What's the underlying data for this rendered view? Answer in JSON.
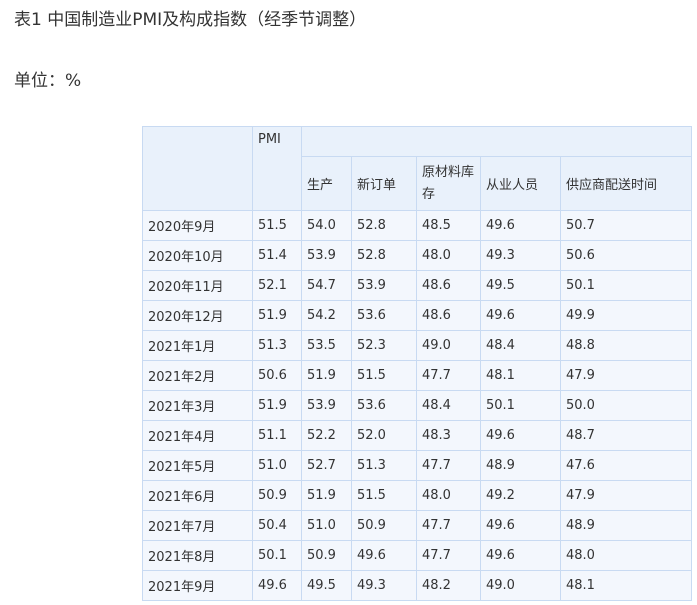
{
  "title": "表1 中国制造业PMI及构成指数（经季节调整）",
  "unit": "单位：%",
  "table": {
    "headers": {
      "pmi": "PMI",
      "production": "生产",
      "new_orders": "新订单",
      "raw_inventory": "原材料库存",
      "employees": "从业人员",
      "delivery_time": "供应商配送时间"
    },
    "rows": [
      [
        "2020年9月",
        "51.5",
        "54.0",
        "52.8",
        "48.5",
        "49.6",
        "50.7"
      ],
      [
        "2020年10月",
        "51.4",
        "53.9",
        "52.8",
        "48.0",
        "49.3",
        "50.6"
      ],
      [
        "2020年11月",
        "52.1",
        "54.7",
        "53.9",
        "48.6",
        "49.5",
        "50.1"
      ],
      [
        "2020年12月",
        "51.9",
        "54.2",
        "53.6",
        "48.6",
        "49.6",
        "49.9"
      ],
      [
        "2021年1月",
        "51.3",
        "53.5",
        "52.3",
        "49.0",
        "48.4",
        "48.8"
      ],
      [
        "2021年2月",
        "50.6",
        "51.9",
        "51.5",
        "47.7",
        "48.1",
        "47.9"
      ],
      [
        "2021年3月",
        "51.9",
        "53.9",
        "53.6",
        "48.4",
        "50.1",
        "50.0"
      ],
      [
        "2021年4月",
        "51.1",
        "52.2",
        "52.0",
        "48.3",
        "49.6",
        "48.7"
      ],
      [
        "2021年5月",
        "51.0",
        "52.7",
        "51.3",
        "47.7",
        "48.9",
        "47.6"
      ],
      [
        "2021年6月",
        "50.9",
        "51.9",
        "51.5",
        "48.0",
        "49.2",
        "47.9"
      ],
      [
        "2021年7月",
        "50.4",
        "51.0",
        "50.9",
        "47.7",
        "49.6",
        "48.9"
      ],
      [
        "2021年8月",
        "50.1",
        "50.9",
        "49.6",
        "47.7",
        "49.6",
        "48.0"
      ],
      [
        "2021年9月",
        "49.6",
        "49.5",
        "49.3",
        "48.2",
        "49.0",
        "48.1"
      ]
    ]
  }
}
